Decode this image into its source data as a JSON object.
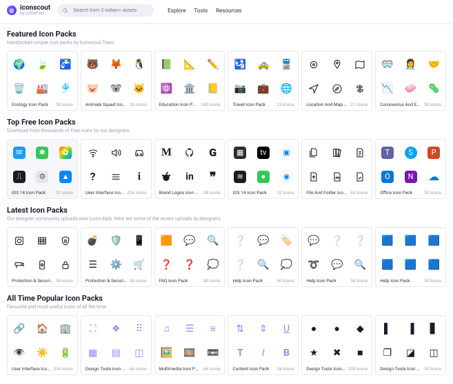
{
  "brand": {
    "name": "iconscout",
    "sub": "by LottieFiles"
  },
  "search": {
    "placeholder": "Search from 3 million+ assets"
  },
  "nav": {
    "explore": "Explore",
    "tools": "Tools",
    "resources": "Resources"
  },
  "sections": {
    "featured": {
      "title": "Featured Icon Packs",
      "sub": "Handpicked unique icon packs by Iconscout Team",
      "packs": [
        {
          "name": "Ecology Icon Pack",
          "count": "30 Icons"
        },
        {
          "name": "Animals Squad Icon Pack",
          "count": "20 Icons"
        },
        {
          "name": "Education Icon Pack",
          "count": "100 Icons"
        },
        {
          "name": "Travel Icon Pack",
          "count": "25 Icons"
        },
        {
          "name": "Location And Map Icon Pack",
          "count": "21 Icons"
        },
        {
          "name": "Coronavirus And Economy Ico…",
          "count": "30 Icons"
        }
      ]
    },
    "topfree": {
      "title": "Top Free Icon Packs",
      "sub": "Download from thousands of Free icons by our designers",
      "packs": [
        {
          "name": "IOS 14 Icon Pack",
          "count": "21 Icons"
        },
        {
          "name": "User Interface Icon Pack",
          "count": "226 Icons"
        },
        {
          "name": "Brand Logos Icon Pack",
          "count": "98 Icons"
        },
        {
          "name": "IOS 14 Icon Pack",
          "count": "32 Icons"
        },
        {
          "name": "File And Folder Icon Pack",
          "count": "65 Icons"
        },
        {
          "name": "Office Icon Pack",
          "count": "20 Icons"
        }
      ]
    },
    "latest": {
      "title": "Latest Icon Packs",
      "sub": "Our designer community uploads new icons daily. Here are some of the recent uploads by designers.",
      "packs": [
        {
          "name": "Protection & Security Icon Pack",
          "count": "50 Icons"
        },
        {
          "name": "Protection & Security Icon Pack",
          "count": "50 Icons"
        },
        {
          "name": "FAQ Icon Pack",
          "count": "50 Icons"
        },
        {
          "name": "Help Icon Pack",
          "count": "50 Icons"
        },
        {
          "name": "Help Icon Pack",
          "count": "50 Icons"
        },
        {
          "name": "Help Icon Pack",
          "count": "50 Icons"
        }
      ]
    },
    "alltime": {
      "title": "All Time Popular Icon Packs",
      "sub": "Favourite and most useful icons of all the time",
      "packs": [
        {
          "name": "User Interface Icon Pack",
          "count": "224 Icons"
        },
        {
          "name": "Design Tools Icon Pack",
          "count": "66 Icons"
        },
        {
          "name": "Multimedia Icon Pack",
          "count": "66 Icons"
        },
        {
          "name": "Content Icon Pack",
          "count": "54 Icons"
        },
        {
          "name": "Design Tools Icon Pack",
          "count": "228 Icons"
        },
        {
          "name": "Design Tools Icon Pack",
          "count": "50 Icons"
        }
      ]
    }
  }
}
